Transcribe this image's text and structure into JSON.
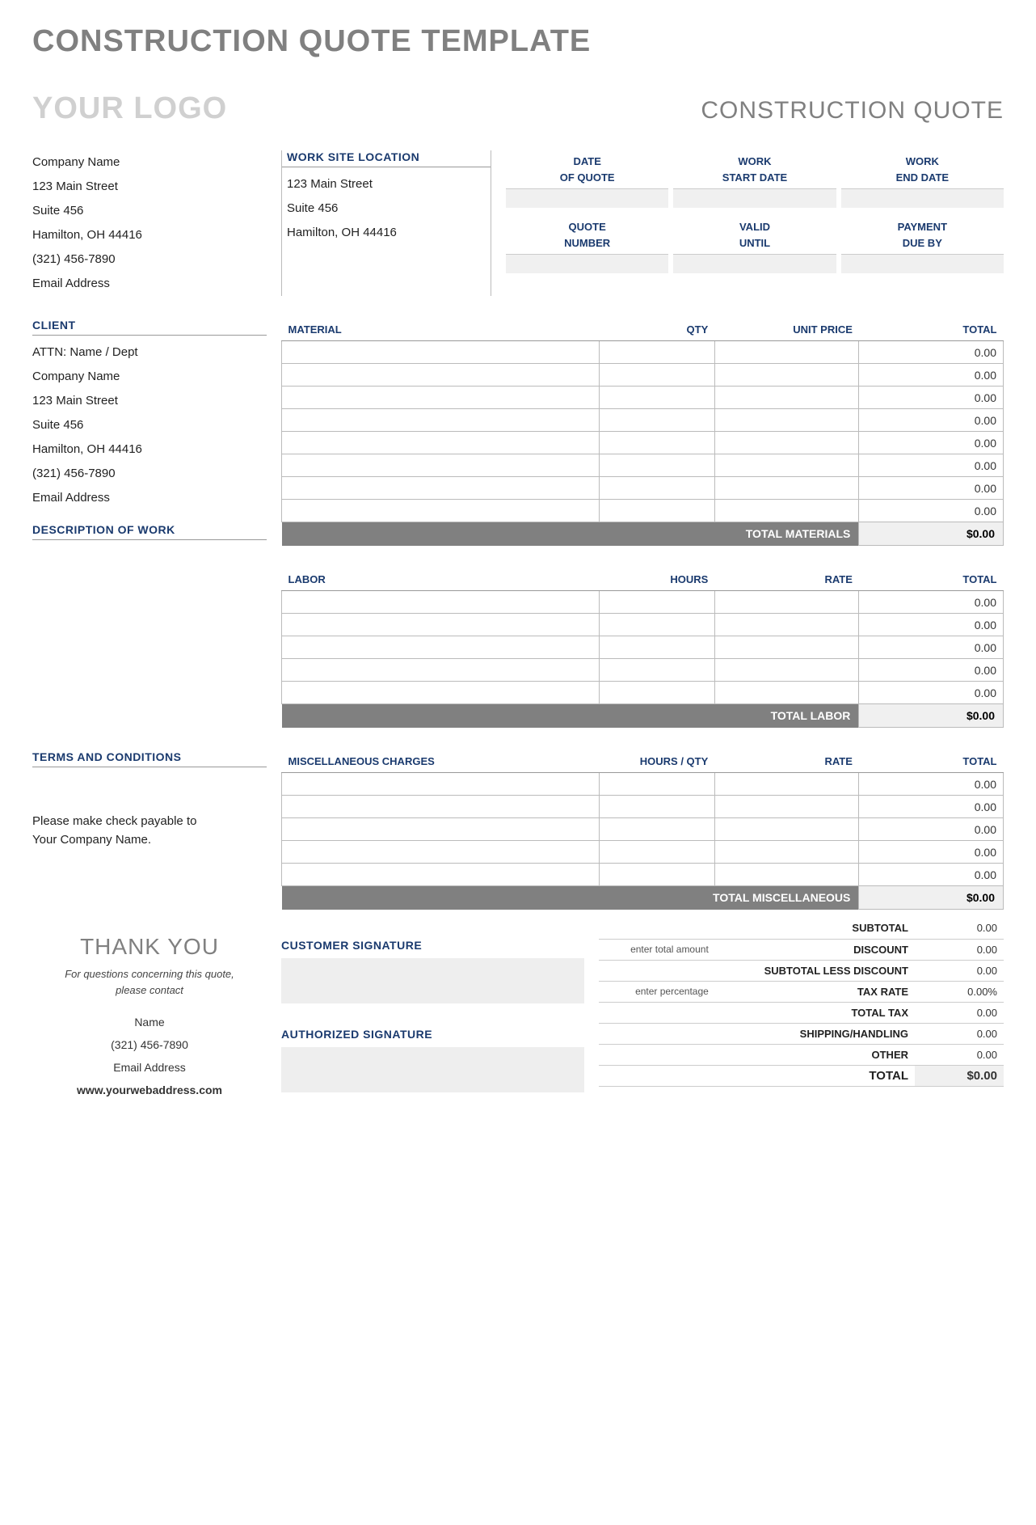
{
  "page_title": "CONSTRUCTION QUOTE TEMPLATE",
  "logo_text": "YOUR LOGO",
  "doc_type": "CONSTRUCTION QUOTE",
  "company": {
    "name": "Company Name",
    "street": "123 Main Street",
    "suite": "Suite 456",
    "city": "Hamilton, OH  44416",
    "phone": "(321) 456-7890",
    "email": "Email Address"
  },
  "worksite": {
    "header": "WORK SITE LOCATION",
    "street": "123 Main Street",
    "suite": "Suite 456",
    "city": "Hamilton, OH  44416"
  },
  "meta_labels": {
    "date_of_quote_l1": "DATE",
    "date_of_quote_l2": "OF QUOTE",
    "work_start_l1": "WORK",
    "work_start_l2": "START DATE",
    "work_end_l1": "WORK",
    "work_end_l2": "END DATE",
    "quote_number_l1": "QUOTE",
    "quote_number_l2": "NUMBER",
    "valid_until_l1": "VALID",
    "valid_until_l2": "UNTIL",
    "payment_due_l1": "PAYMENT",
    "payment_due_l2": "DUE BY"
  },
  "client": {
    "header": "CLIENT",
    "attn": "ATTN: Name / Dept",
    "name": "Company Name",
    "street": "123 Main Street",
    "suite": "Suite 456",
    "city": "Hamilton, OH  44416",
    "phone": "(321) 456-7890",
    "email": "Email Address"
  },
  "desc_header": "DESCRIPTION OF WORK",
  "materials": {
    "headers": {
      "material": "MATERIAL",
      "qty": "QTY",
      "unit_price": "UNIT PRICE",
      "total": "TOTAL"
    },
    "rows": [
      {
        "material": "",
        "qty": "",
        "unit_price": "",
        "total": "0.00"
      },
      {
        "material": "",
        "qty": "",
        "unit_price": "",
        "total": "0.00"
      },
      {
        "material": "",
        "qty": "",
        "unit_price": "",
        "total": "0.00"
      },
      {
        "material": "",
        "qty": "",
        "unit_price": "",
        "total": "0.00"
      },
      {
        "material": "",
        "qty": "",
        "unit_price": "",
        "total": "0.00"
      },
      {
        "material": "",
        "qty": "",
        "unit_price": "",
        "total": "0.00"
      },
      {
        "material": "",
        "qty": "",
        "unit_price": "",
        "total": "0.00"
      },
      {
        "material": "",
        "qty": "",
        "unit_price": "",
        "total": "0.00"
      }
    ],
    "total_label": "TOTAL MATERIALS",
    "total_value": "$0.00"
  },
  "labor": {
    "headers": {
      "labor": "LABOR",
      "hours": "HOURS",
      "rate": "RATE",
      "total": "TOTAL"
    },
    "rows": [
      {
        "labor": "",
        "hours": "",
        "rate": "",
        "total": "0.00"
      },
      {
        "labor": "",
        "hours": "",
        "rate": "",
        "total": "0.00"
      },
      {
        "labor": "",
        "hours": "",
        "rate": "",
        "total": "0.00"
      },
      {
        "labor": "",
        "hours": "",
        "rate": "",
        "total": "0.00"
      },
      {
        "labor": "",
        "hours": "",
        "rate": "",
        "total": "0.00"
      }
    ],
    "total_label": "TOTAL LABOR",
    "total_value": "$0.00"
  },
  "terms": {
    "header": "TERMS AND CONDITIONS",
    "text1": "Please make check payable to",
    "text2": "Your Company Name."
  },
  "misc": {
    "headers": {
      "misc": "MISCELLANEOUS CHARGES",
      "hours_qty": "HOURS / QTY",
      "rate": "RATE",
      "total": "TOTAL"
    },
    "rows": [
      {
        "desc": "",
        "hq": "",
        "rate": "",
        "total": "0.00"
      },
      {
        "desc": "",
        "hq": "",
        "rate": "",
        "total": "0.00"
      },
      {
        "desc": "",
        "hq": "",
        "rate": "",
        "total": "0.00"
      },
      {
        "desc": "",
        "hq": "",
        "rate": "",
        "total": "0.00"
      },
      {
        "desc": "",
        "hq": "",
        "rate": "",
        "total": "0.00"
      }
    ],
    "total_label": "TOTAL MISCELLANEOUS",
    "total_value": "$0.00"
  },
  "summary": {
    "subtotal_label": "SUBTOTAL",
    "subtotal_value": "0.00",
    "discount_hint": "enter total amount",
    "discount_label": "DISCOUNT",
    "discount_value": "0.00",
    "subless_label": "SUBTOTAL LESS DISCOUNT",
    "subless_value": "0.00",
    "taxrate_hint": "enter percentage",
    "taxrate_label": "TAX RATE",
    "taxrate_value": "0.00%",
    "totaltax_label": "TOTAL TAX",
    "totaltax_value": "0.00",
    "shipping_label": "SHIPPING/HANDLING",
    "shipping_value": "0.00",
    "other_label": "OTHER",
    "other_value": "0.00",
    "total_label": "TOTAL",
    "total_value": "$0.00"
  },
  "thank_you": "THANK YOU",
  "contact_note_l1": "For questions concerning this quote,",
  "contact_note_l2": "please contact",
  "contact": {
    "name": "Name",
    "phone": "(321) 456-7890",
    "email": "Email Address",
    "web": "www.yourwebaddress.com"
  },
  "sig": {
    "customer": "CUSTOMER SIGNATURE",
    "authorized": "AUTHORIZED SIGNATURE"
  }
}
